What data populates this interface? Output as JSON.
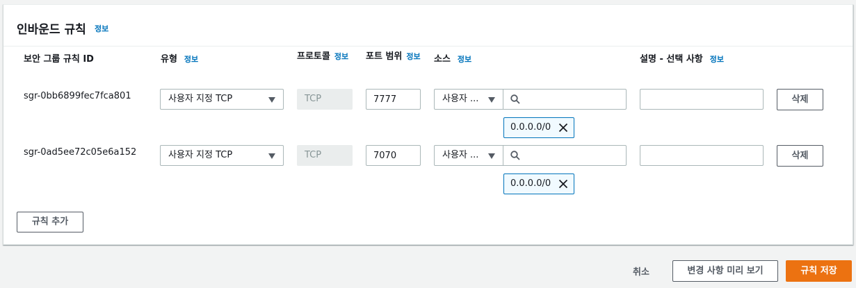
{
  "panel": {
    "title": "인바운드 규칙",
    "title_info": "정보"
  },
  "columns": {
    "rule_id": "보안 그룹 규칙 ID",
    "type": "유형",
    "type_info": "정보",
    "protocol": "프로토콜",
    "protocol_info": "정보",
    "port_range": "포트 범위",
    "port_range_info": "정보",
    "source": "소스",
    "source_info": "정보",
    "description": "설명 - 선택 사항",
    "description_info": "정보"
  },
  "rules": [
    {
      "id": "sgr-0bb6899fec7fca801",
      "type": "사용자 지정 TCP",
      "protocol": "TCP",
      "port_range": "7777",
      "source_type": "사용자 ...",
      "search_value": "",
      "cidr_token": "0.0.0.0/0",
      "description": "",
      "delete_label": "삭제"
    },
    {
      "id": "sgr-0ad5ee72c05e6a152",
      "type": "사용자 지정 TCP",
      "protocol": "TCP",
      "port_range": "7070",
      "source_type": "사용자 ...",
      "search_value": "",
      "cidr_token": "0.0.0.0/0",
      "description": "",
      "delete_label": "삭제"
    }
  ],
  "add_rule_label": "규칙 추가",
  "footer": {
    "cancel_label": "취소",
    "preview_label": "변경 사항 미리 보기",
    "save_label": "규칙 저장"
  },
  "icons": {
    "search": "search-icon",
    "close": "close-icon",
    "caret": "caret-down-icon"
  },
  "colors": {
    "primary_button": "#ec7211",
    "link": "#0073bb",
    "token_border": "#0073bb",
    "page_background": "#f2f3f3"
  }
}
